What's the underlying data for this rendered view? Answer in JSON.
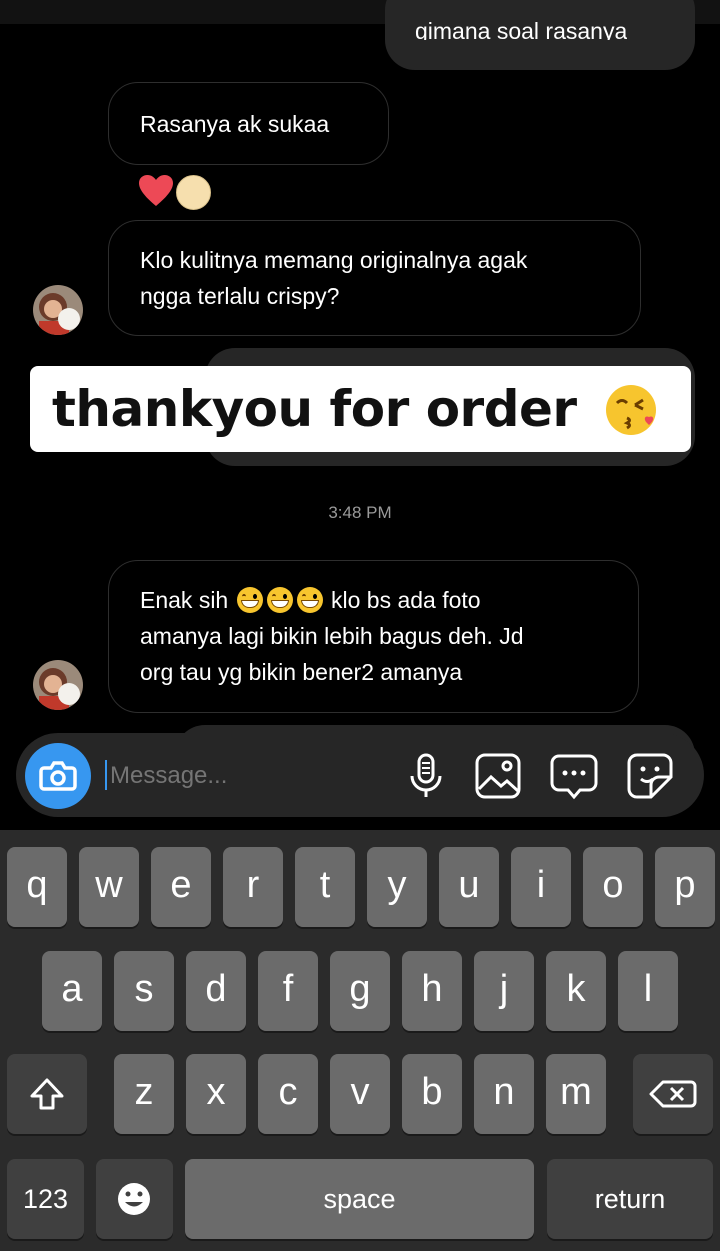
{
  "chat": {
    "outgoing_partial": "gimana soal rasanya",
    "msg1": "Rasanya ak sukaa",
    "msg2_line1": "Klo kulitnya memang originalnya agak",
    "msg2_line2": "ngga terlalu crispy?",
    "overlay_text": "thankyou for order",
    "timestamp": "3:48 PM",
    "msg3_part1": "Enak sih",
    "msg3_part2": "klo bs ada foto",
    "msg3_line2": "amanya lagi bikin lebih bagus deh. Jd",
    "msg3_line3": "org tau yg bikin bener2 amanya"
  },
  "composer": {
    "placeholder": "Message..."
  },
  "keyboard": {
    "row1": [
      "q",
      "w",
      "e",
      "r",
      "t",
      "y",
      "u",
      "i",
      "o",
      "p"
    ],
    "row2": [
      "a",
      "s",
      "d",
      "f",
      "g",
      "h",
      "j",
      "k",
      "l"
    ],
    "row3": [
      "z",
      "x",
      "c",
      "v",
      "b",
      "n",
      "m"
    ],
    "numbers_label": "123",
    "space_label": "space",
    "return_label": "return"
  },
  "colors": {
    "accent_blue": "#3797f0",
    "heart": "#ed4956"
  }
}
